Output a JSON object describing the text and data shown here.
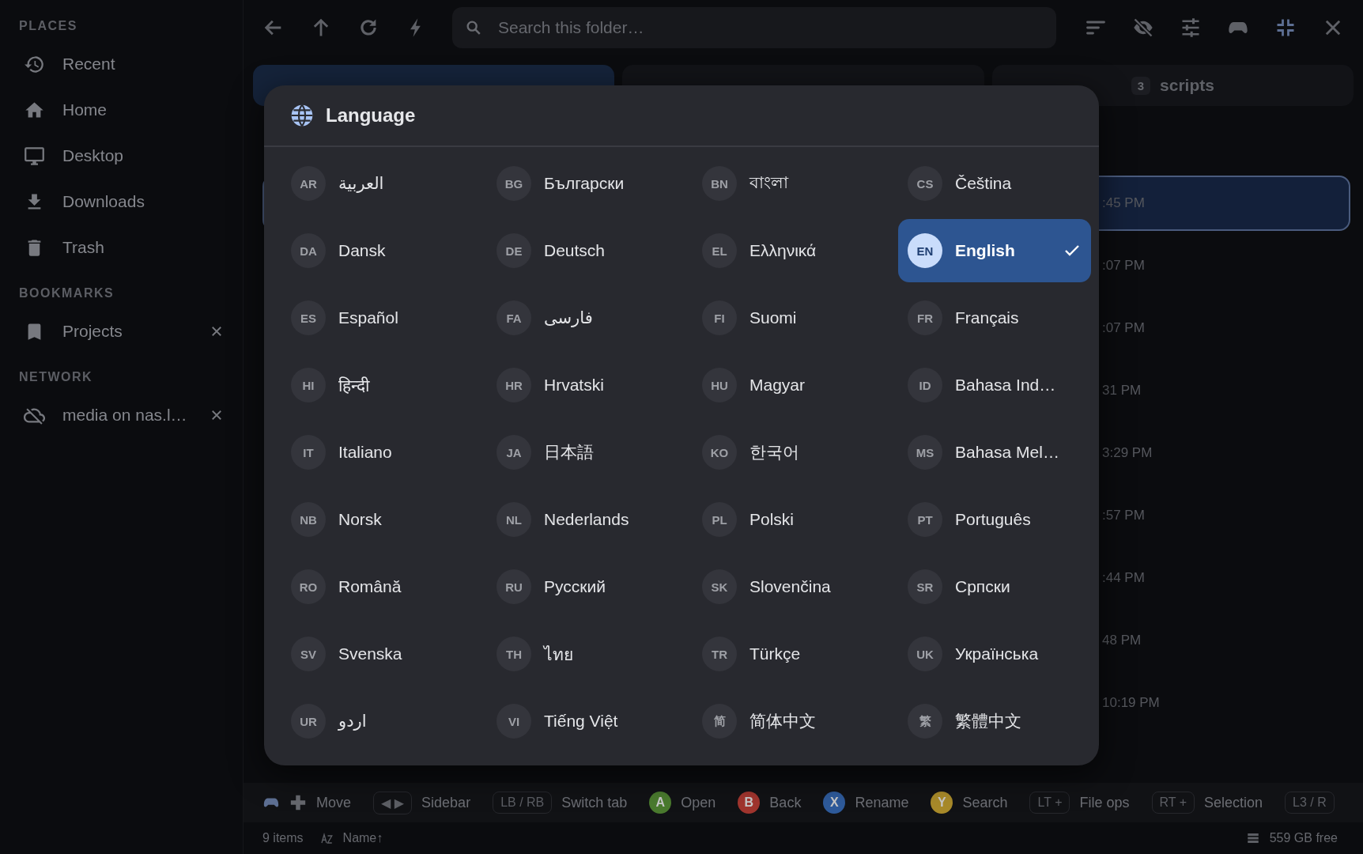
{
  "sidebar": {
    "sections": [
      {
        "title": "PLACES",
        "items": [
          {
            "label": "Recent",
            "removable": false
          },
          {
            "label": "Home",
            "removable": false
          },
          {
            "label": "Desktop",
            "removable": false
          },
          {
            "label": "Downloads",
            "removable": false
          },
          {
            "label": "Trash",
            "removable": false
          }
        ]
      },
      {
        "title": "BOOKMARKS",
        "items": [
          {
            "label": "Projects",
            "removable": true
          }
        ]
      },
      {
        "title": "NETWORK",
        "items": [
          {
            "label": "media on nas.l…",
            "removable": true
          }
        ]
      }
    ]
  },
  "toolbar": {
    "search": {
      "placeholder": "Search this folder…"
    }
  },
  "tabs": [
    {
      "selected": true
    },
    {
      "selected": false
    },
    {
      "number": "3",
      "label": "scripts",
      "selected": false
    }
  ],
  "file_rows": [
    {
      "time": ":45 PM",
      "selected": true
    },
    {
      "time": ":07 PM",
      "selected": false
    },
    {
      "time": ":07 PM",
      "selected": false
    },
    {
      "time": "31 PM",
      "selected": false
    },
    {
      "time": "3:29 PM",
      "selected": false
    },
    {
      "time": ":57 PM",
      "selected": false
    },
    {
      "time": ":44 PM",
      "selected": false
    },
    {
      "time": "48 PM",
      "selected": false
    },
    {
      "time": "10:19 PM",
      "selected": false
    }
  ],
  "dialog": {
    "title": "Language",
    "languages": [
      {
        "code": "AR",
        "name": "العربية",
        "selected": false
      },
      {
        "code": "BG",
        "name": "Български",
        "selected": false
      },
      {
        "code": "BN",
        "name": "বাংলা",
        "selected": false
      },
      {
        "code": "CS",
        "name": "Čeština",
        "selected": false
      },
      {
        "code": "DA",
        "name": "Dansk",
        "selected": false
      },
      {
        "code": "DE",
        "name": "Deutsch",
        "selected": false
      },
      {
        "code": "EL",
        "name": "Ελληνικά",
        "selected": false
      },
      {
        "code": "EN",
        "name": "English",
        "selected": true
      },
      {
        "code": "ES",
        "name": "Español",
        "selected": false
      },
      {
        "code": "FA",
        "name": "فارسی",
        "selected": false
      },
      {
        "code": "FI",
        "name": "Suomi",
        "selected": false
      },
      {
        "code": "FR",
        "name": "Français",
        "selected": false
      },
      {
        "code": "HI",
        "name": "हिन्दी",
        "selected": false
      },
      {
        "code": "HR",
        "name": "Hrvatski",
        "selected": false
      },
      {
        "code": "HU",
        "name": "Magyar",
        "selected": false
      },
      {
        "code": "ID",
        "name": "Bahasa Ind…",
        "selected": false
      },
      {
        "code": "IT",
        "name": "Italiano",
        "selected": false
      },
      {
        "code": "JA",
        "name": "日本語",
        "selected": false
      },
      {
        "code": "KO",
        "name": "한국어",
        "selected": false
      },
      {
        "code": "MS",
        "name": "Bahasa Mel…",
        "selected": false
      },
      {
        "code": "NB",
        "name": "Norsk",
        "selected": false
      },
      {
        "code": "NL",
        "name": "Nederlands",
        "selected": false
      },
      {
        "code": "PL",
        "name": "Polski",
        "selected": false
      },
      {
        "code": "PT",
        "name": "Português",
        "selected": false
      },
      {
        "code": "RO",
        "name": "Română",
        "selected": false
      },
      {
        "code": "RU",
        "name": "Русский",
        "selected": false
      },
      {
        "code": "SK",
        "name": "Slovenčina",
        "selected": false
      },
      {
        "code": "SR",
        "name": "Српски",
        "selected": false
      },
      {
        "code": "SV",
        "name": "Svenska",
        "selected": false
      },
      {
        "code": "TH",
        "name": "ไทย",
        "selected": false
      },
      {
        "code": "TR",
        "name": "Türkçe",
        "selected": false
      },
      {
        "code": "UK",
        "name": "Українська",
        "selected": false
      },
      {
        "code": "UR",
        "name": "اردو",
        "selected": false
      },
      {
        "code": "VI",
        "name": "Tiếng Việt",
        "selected": false
      },
      {
        "code": "简",
        "name": "简体中文",
        "selected": false
      },
      {
        "code": "繁",
        "name": "繁體中文",
        "selected": false
      }
    ]
  },
  "controls_bar": {
    "hints": [
      {
        "kind": "gamepad"
      },
      {
        "kind": "dpad",
        "label": "Move"
      },
      {
        "kind": "key",
        "key": "◀ ▶",
        "label": "Sidebar"
      },
      {
        "kind": "key",
        "key": "LB / RB",
        "label": "Switch tab"
      },
      {
        "kind": "button",
        "key": "A",
        "color": "#4a7a2e",
        "label": "Open"
      },
      {
        "kind": "button",
        "key": "B",
        "color": "#a0352e",
        "label": "Back"
      },
      {
        "kind": "button",
        "key": "X",
        "color": "#2e5a9a",
        "label": "Rename"
      },
      {
        "kind": "button",
        "key": "Y",
        "color": "#a88a2a",
        "label": "Search"
      },
      {
        "kind": "key",
        "key": "LT +",
        "label": "File ops"
      },
      {
        "kind": "key",
        "key": "RT +",
        "label": "Selection"
      },
      {
        "kind": "key",
        "key": "L3 / R"
      }
    ]
  },
  "status_bar": {
    "count": "9 items",
    "sort": "Name↑",
    "free": "559 GB free"
  }
}
